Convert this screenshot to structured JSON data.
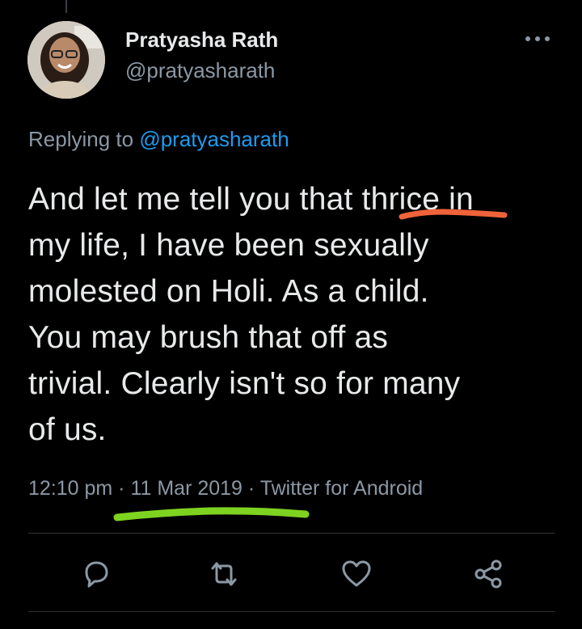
{
  "tweet": {
    "author_name": "Pratyasha Rath",
    "author_handle": "@pratyasharath",
    "replying_prefix": "Replying to",
    "replying_handle": "@pratyasharath",
    "text_lines": [
      "And let me tell you that thrice in",
      "my life, I have been sexually",
      "molested on Holi. As a child.",
      "You may brush that off as",
      "trivial. Clearly isn't so for many",
      "of us."
    ],
    "meta": "12:10 pm · 11 Mar 2019 · Twitter for Android"
  },
  "icons": {
    "more": "more-horizontal-icon",
    "reply": "reply-icon",
    "retweet": "retweet-icon",
    "like": "heart-icon",
    "share": "share-icon"
  },
  "colors": {
    "background": "#000000",
    "link": "#1d9bf0",
    "secondary_text": "#8b98a5",
    "underline_orange": "#f0633a",
    "underline_green": "#7ed321"
  }
}
